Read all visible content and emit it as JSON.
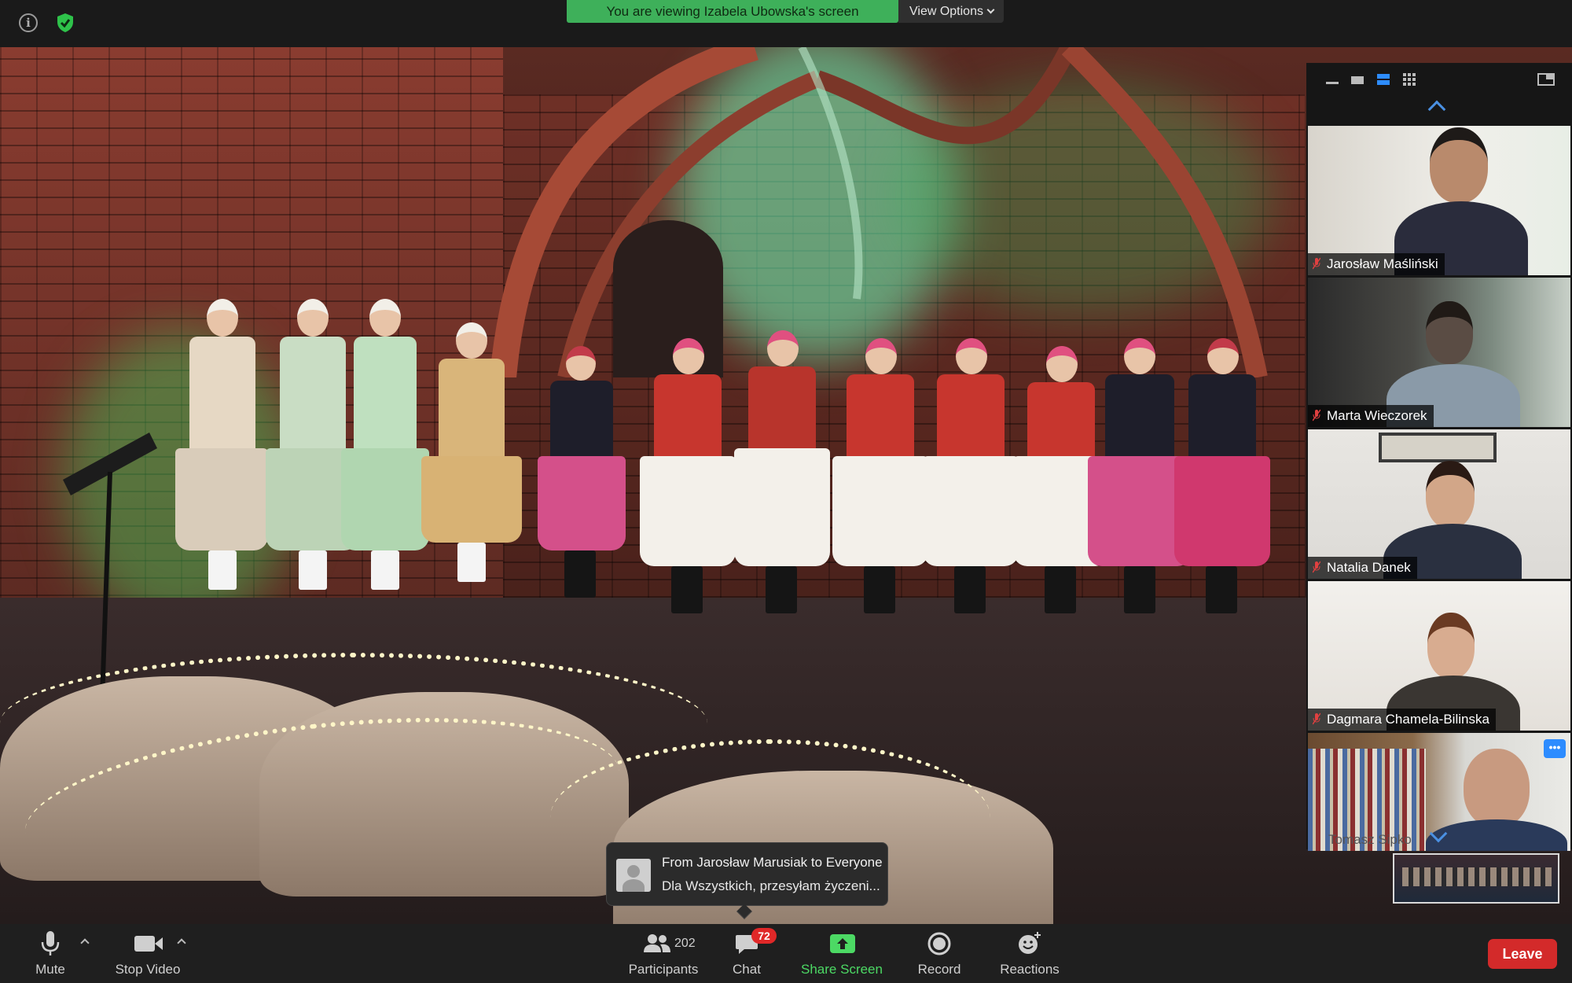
{
  "topbar": {
    "banner_text": "You are viewing Izabela Ubowska's screen",
    "view_options_label": "View Options"
  },
  "chat_notification": {
    "from": "From Jarosław Marusiak to Everyone",
    "message": "Dla Wszystkich, przesyłam życzeni..."
  },
  "gallery": {
    "participants": [
      {
        "name": "Jarosław Maśliński",
        "muted": true
      },
      {
        "name": "Marta Wieczorek",
        "muted": true
      },
      {
        "name": "Natalia Danek",
        "muted": true
      },
      {
        "name": "Dagmara Chamela-Bilinska",
        "muted": true
      },
      {
        "name": "Tomasz Sipko",
        "muted": false
      }
    ]
  },
  "toolbar": {
    "mute_label": "Mute",
    "stop_video_label": "Stop Video",
    "participants_label": "Participants",
    "participants_count": "202",
    "chat_label": "Chat",
    "chat_badge": "72",
    "share_screen_label": "Share Screen",
    "record_label": "Record",
    "reactions_label": "Reactions",
    "leave_label": "Leave"
  },
  "colors": {
    "accent_green": "#3eb05a",
    "share_green": "#4cd964",
    "leave_red": "#d32a2a",
    "badge_red": "#e02828",
    "active_blue": "#2d8cff"
  }
}
